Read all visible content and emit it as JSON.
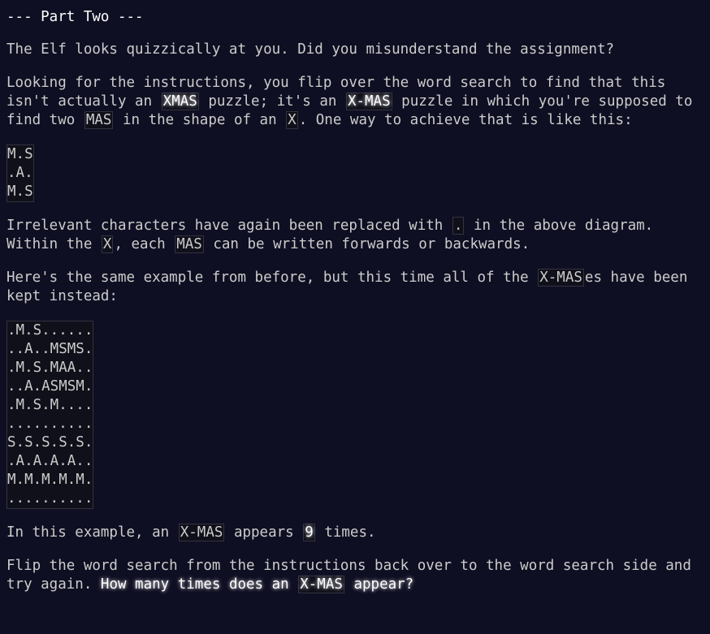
{
  "heading": "--- Part Two ---",
  "p1": "The Elf looks quizzically at you. Did you misunderstand the assignment?",
  "p2": {
    "t1": "Looking for the instructions, you flip over the word search to find that this isn't actually an ",
    "c1": "XMAS",
    "t2": " puzzle; it's an ",
    "c2": "X-MAS",
    "t3": " puzzle in which you're supposed to find two ",
    "c3": "MAS",
    "t4": " in the shape of an ",
    "c4": "X",
    "t5": ". One way to achieve that is like this:"
  },
  "diagram1": [
    "M.S",
    ".A.",
    "M.S"
  ],
  "p3": {
    "t1": "Irrelevant characters have again been replaced with ",
    "c1": ".",
    "t2": " in the above diagram. Within the ",
    "c2": "X",
    "t3": ", each ",
    "c3": "MAS",
    "t4": " can be written forwards or backwards."
  },
  "p4": {
    "t1": "Here's the same example from before, but this time all of the ",
    "c1": "X-MAS",
    "t2": "es have been kept instead:"
  },
  "diagram2": [
    ".M.S......",
    "..A..MSMS.",
    ".M.S.MAA..",
    "..A.ASMSM.",
    ".M.S.M....",
    "..........",
    "S.S.S.S.S.",
    ".A.A.A.A..",
    "M.M.M.M.M.",
    ".........."
  ],
  "p5": {
    "t1": "In this example, an ",
    "c1": "X-MAS",
    "t2": " appears ",
    "c2": "9",
    "t3": " times."
  },
  "p6": {
    "t1": "Flip the word search from the instructions back over to the word search side and try again. ",
    "em1": "How many times does an ",
    "c1": "X-MAS",
    "em2": " appear?"
  }
}
